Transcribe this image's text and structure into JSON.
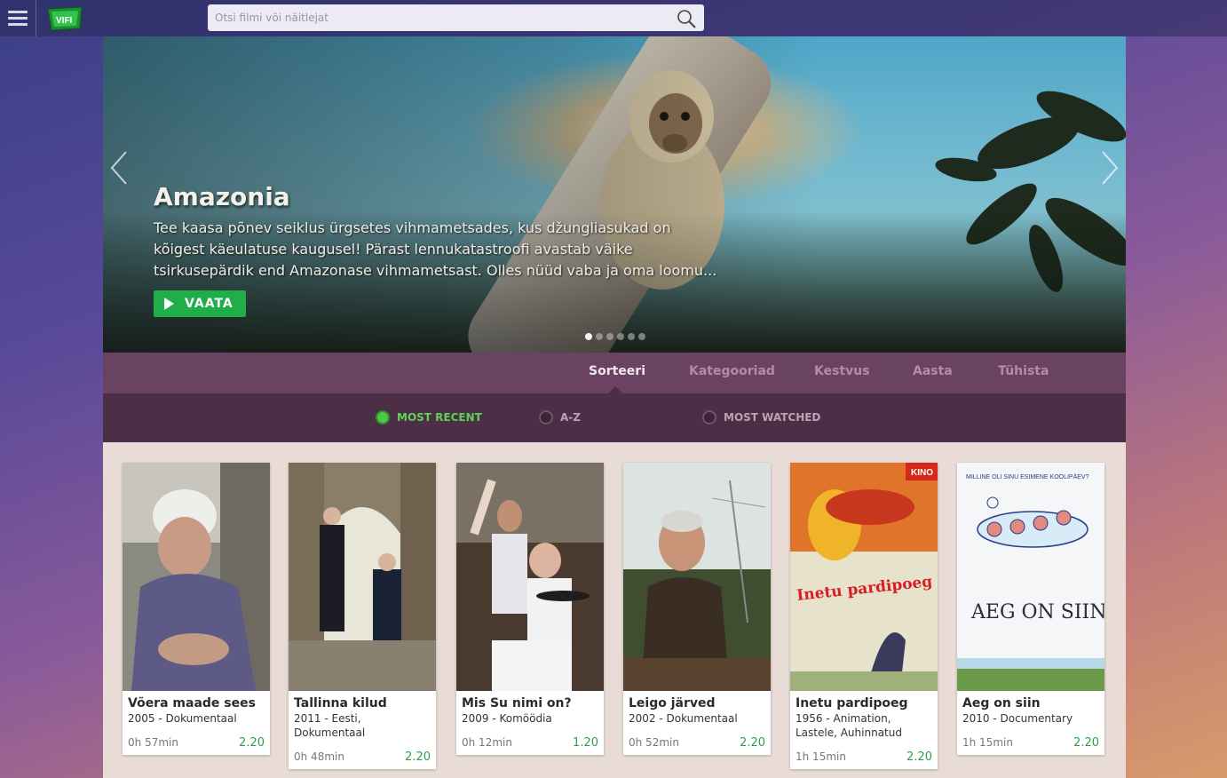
{
  "topbar": {
    "logo_text": "VIFI",
    "search_placeholder": "Otsi filmi või näitlejat"
  },
  "hero": {
    "title": "Amazonia",
    "description": "Tee kaasa põnev seiklus ürgsetes vihmametsades, kus džungliasukad on kõigest käeulatuse kaugusel! Pärast lennukatastroofi avastab väike tsirkusepärdik end Amazonase vihmametsast. Olles nüüd vaba ja oma loomu...",
    "watch_label": "VAATA",
    "slide_count": 6,
    "active_slide": 1
  },
  "filters": {
    "tabs": [
      "Sorteeri",
      "Kategooriad",
      "Kestvus",
      "Aasta",
      "Tühista"
    ],
    "active_tab": "Sorteeri"
  },
  "sort": {
    "options": [
      "MOST RECENT",
      "A-Z",
      "MOST WATCHED"
    ],
    "selected": "MOST RECENT"
  },
  "movies": [
    {
      "title": "Võera maade sees",
      "meta": "2005 - Dokumentaal",
      "duration": "0h 57min",
      "price": "2.20"
    },
    {
      "title": "Tallinna kilud",
      "meta": "2011 - Eesti, Dokumentaal",
      "duration": "0h 48min",
      "price": "2.20"
    },
    {
      "title": "Mis Su nimi on?",
      "meta": "2009 - Komöödia",
      "duration": "0h 12min",
      "price": "1.20"
    },
    {
      "title": "Leigo järved",
      "meta": "2002 - Dokumentaal",
      "duration": "0h 52min",
      "price": "2.20"
    },
    {
      "title": "Inetu pardipoeg",
      "meta": "1956 - Animation, Lastele, Auhinnatud",
      "duration": "1h 15min",
      "price": "2.20"
    },
    {
      "title": "Aeg on siin",
      "meta": "2010 - Documentary",
      "duration": "1h 15min",
      "price": "2.20"
    }
  ],
  "posters": {
    "p5_text": "Inetu pardipoeg",
    "p5_badge": "KINO",
    "p6_top": "MILLINE OLI SINU ESIMENE KOOLIPÄEV?",
    "p6_title": "AEG ON SIIN"
  },
  "colors": {
    "accent_green": "#1fae4a",
    "filter_bg": "#6b4362",
    "sort_bg": "#4d2e47",
    "grid_bg": "#e9dcd6"
  }
}
